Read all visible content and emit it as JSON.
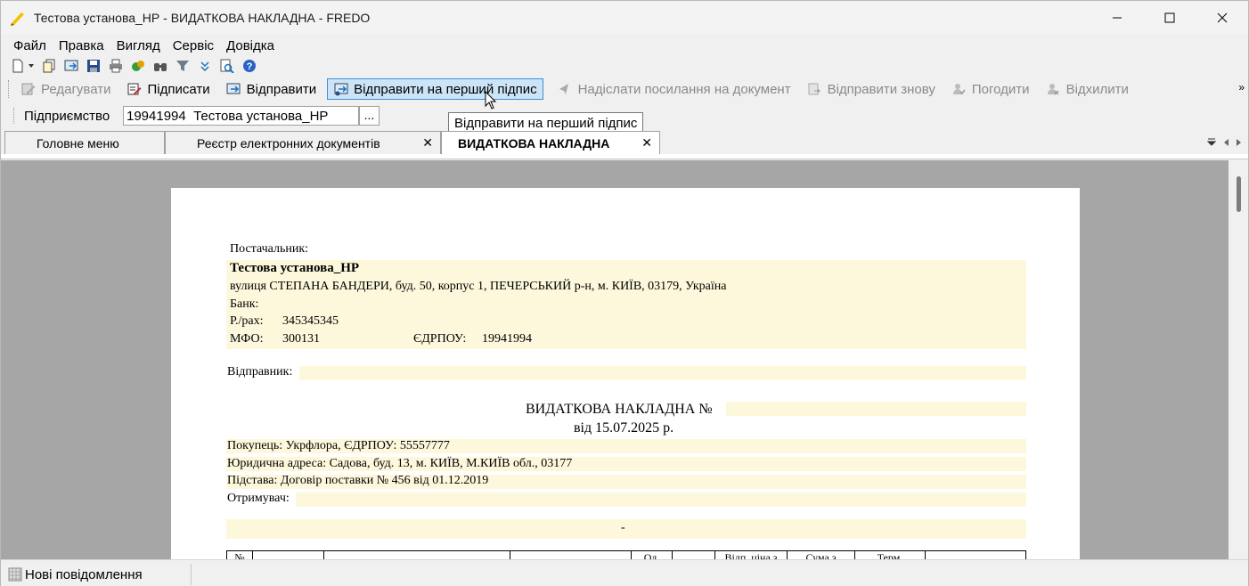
{
  "window": {
    "title": "Тестова установа_НР - ВИДАТКОВА НАКЛАДНА - FREDO"
  },
  "menu": [
    "Файл",
    "Правка",
    "Вигляд",
    "Сервіс",
    "Довідка"
  ],
  "toolbar_icons": [
    "new-doc-icon",
    "dropdown-icon",
    "copy-doc-icon",
    "open-icon",
    "save-icon",
    "print-icon",
    "export-icon",
    "find-icon",
    "filter-icon",
    "expand-icon",
    "preview-icon",
    "help-icon"
  ],
  "actions": [
    {
      "label": "Редагувати",
      "icon": "edit-icon",
      "enabled": false
    },
    {
      "label": "Підписати",
      "icon": "sign-icon",
      "enabled": true
    },
    {
      "label": "Відправити",
      "icon": "send-icon",
      "enabled": true
    },
    {
      "label": "Відправити на перший підпис",
      "icon": "send-first-sign-icon",
      "enabled": true,
      "hovered": true
    },
    {
      "label": "Надіслати посилання на документ",
      "icon": "send-link-icon",
      "enabled": false
    },
    {
      "label": "Відправити знову",
      "icon": "resend-icon",
      "enabled": false
    },
    {
      "label": "Погодити",
      "icon": "approve-icon",
      "enabled": false
    },
    {
      "label": "Відхилити",
      "icon": "reject-icon",
      "enabled": false
    }
  ],
  "more_label": "»",
  "enterprise": {
    "label": "Підприємство",
    "code": "19941994",
    "name": "Тестова установа_НР",
    "browse": "..."
  },
  "tooltip": "Відправити на перший підпис",
  "tabs": [
    {
      "label": "Головне меню",
      "closable": false
    },
    {
      "label": "Реєстр електронних документів",
      "closable": true
    },
    {
      "label": "ВИДАТКОВА НАКЛАДНА",
      "closable": true,
      "active": true
    }
  ],
  "close_glyph": "✕",
  "document": {
    "supplier_label": "Постачальник:",
    "supplier_name": "Тестова установа_НР",
    "supplier_address": "вулиця СТЕПАНА БАНДЕРИ, буд. 50, корпус 1, ПЕЧЕРСЬКИЙ р-н, м. КИЇВ, 03179, Україна",
    "bank_label": "Банк:",
    "account_label": "Р./рах:",
    "account": "345345345",
    "mfo_label": "МФО:",
    "mfo": "300131",
    "edrpou_label": "ЄДРПОУ:",
    "edrpou": "19941994",
    "sender_label": "Відправник:",
    "doc_title": "ВИДАТКОВА НАКЛАДНА №",
    "doc_date": "від 15.07.2025 р.",
    "buyer": "Покупець: Укрфлора, ЄДРПОУ: 55557777",
    "legal_address": "Юридична адреса: Садова, буд. 13, м. КИЇВ, М.КИЇВ обл., 03177",
    "basis": "Підстава: Договір поставки № 456 від 01.12.2019",
    "receiver": "Отримувач:",
    "dash": "-",
    "table_headers": [
      "№",
      "",
      "",
      "",
      "Од.",
      "",
      "Відп. ціна з",
      "Сума з",
      "Терм.",
      ""
    ]
  },
  "status": {
    "messages": "Нові повідомлення"
  }
}
